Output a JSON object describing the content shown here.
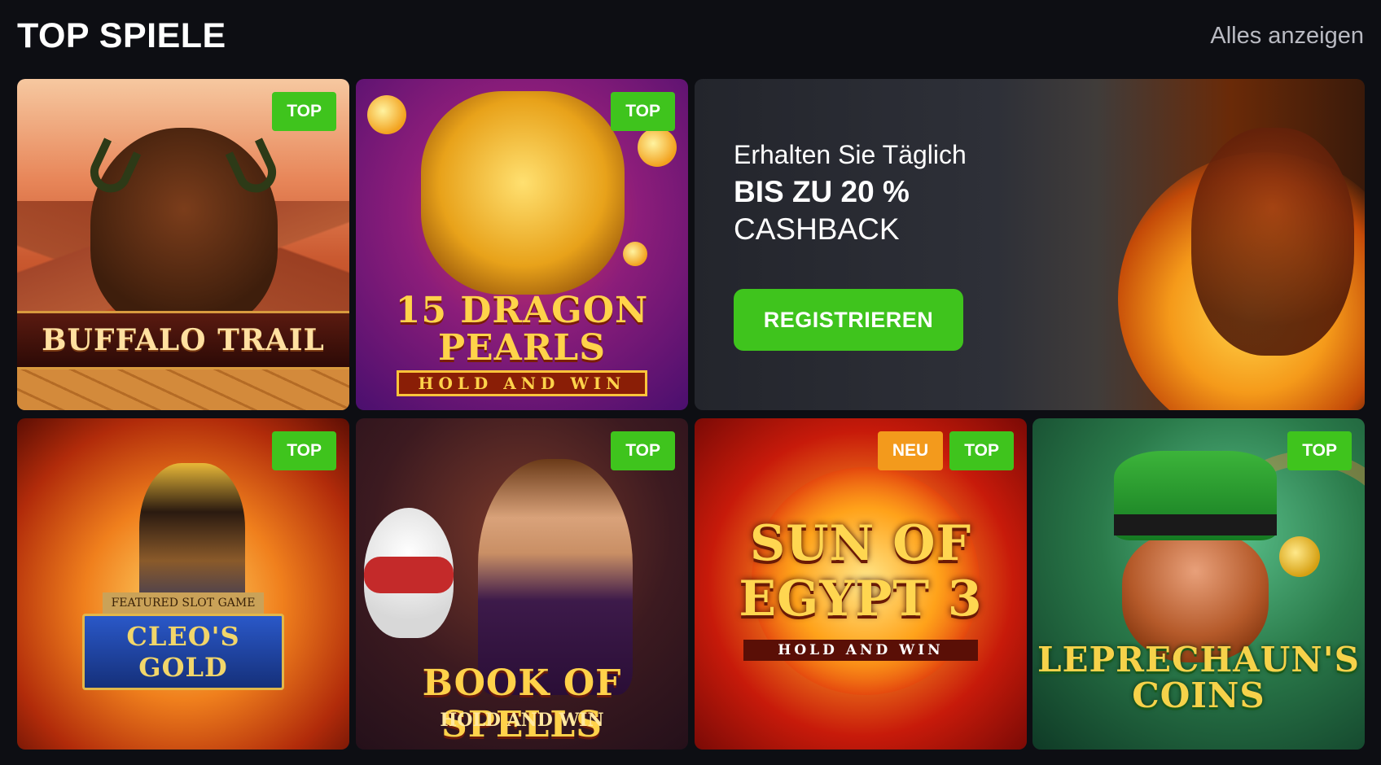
{
  "section": {
    "title": "TOP SPIELE",
    "view_all": "Alles anzeigen"
  },
  "games": [
    {
      "name": "BUFFALO TRAIL",
      "badges": [
        "TOP"
      ]
    },
    {
      "name": "15 DRAGON PEARLS",
      "subtitle": "HOLD AND WIN",
      "badges": [
        "TOP"
      ]
    },
    {
      "name": "CLEO'S GOLD",
      "tagline": "FEATURED SLOT GAME",
      "badges": [
        "TOP"
      ]
    },
    {
      "name": "BOOK OF SPELLS",
      "subtitle": "HOLD AND WIN",
      "badges": [
        "TOP"
      ]
    },
    {
      "name": "SUN OF EGYPT 3",
      "subtitle": "HOLD AND WIN",
      "badges": [
        "NEU",
        "TOP"
      ]
    },
    {
      "name": "LEPRECHAUN'S COINS",
      "badges": [
        "TOP"
      ]
    }
  ],
  "promo": {
    "line1": "Erhalten Sie Täglich",
    "line2": "BIS ZU 20 %",
    "line3": "CASHBACK",
    "button": "REGISTRIEREN"
  },
  "colors": {
    "background": "#0d0e13",
    "badge_top": "#3fc41d",
    "badge_new": "#f39a1c",
    "cta": "#3fc41d"
  },
  "icons": []
}
